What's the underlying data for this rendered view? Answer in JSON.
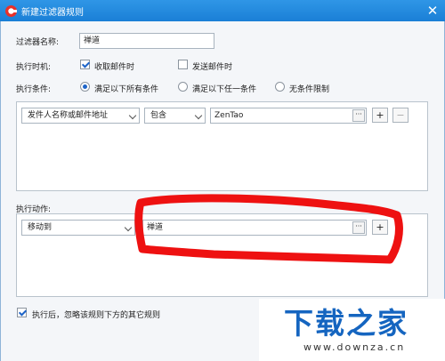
{
  "window": {
    "title": "新建过滤器规则",
    "close_symbol": "✕",
    "brand_color": "#1a7fd6"
  },
  "filter_name": {
    "label": "过滤器名称:",
    "value": "禅道"
  },
  "timing": {
    "label": "执行时机:",
    "options": [
      {
        "label": "收取邮件时",
        "checked": true
      },
      {
        "label": "发送邮件时",
        "checked": false
      }
    ]
  },
  "conditions_mode": {
    "label": "执行条件:",
    "options": [
      {
        "label": "满足以下所有条件",
        "selected": true
      },
      {
        "label": "满足以下任一条件",
        "selected": false
      },
      {
        "label": "无条件限制",
        "selected": false
      }
    ]
  },
  "condition_row": {
    "field": "发件人名称或邮件地址",
    "operator": "包含",
    "value": "ZenTao",
    "ellipsis": "···",
    "add": "+",
    "remove": "−"
  },
  "actions": {
    "label": "执行动作:",
    "row": {
      "action": "移动到",
      "target": "禅道",
      "ellipsis": "···",
      "add": "+"
    }
  },
  "footer": {
    "stop_rules_label": "执行后，忽略该规则下方的其它规则",
    "stop_rules_checked": true
  },
  "watermark": {
    "title": "下载之家",
    "url": "www.downza.cn"
  },
  "annotation": {
    "color": "#ee1111"
  },
  "icons": [
    "app-logo-icon",
    "close-icon",
    "checkbox-icon",
    "radio-icon",
    "dropdown-arrow-icon",
    "ellipsis-icon",
    "plus-icon",
    "minus-icon"
  ]
}
